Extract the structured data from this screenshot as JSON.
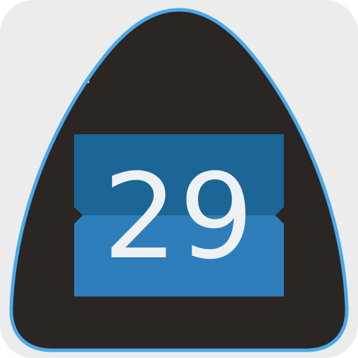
{
  "app_icon": {
    "name": "Calendar",
    "day": "29",
    "colors": {
      "background": "#ececec",
      "shield_fill": "#2b2623",
      "shield_outline": "#4aa9ea",
      "tile_top": "#1b6597",
      "tile_bottom": "#2e7ebb",
      "digits": "#eef1f4"
    }
  }
}
